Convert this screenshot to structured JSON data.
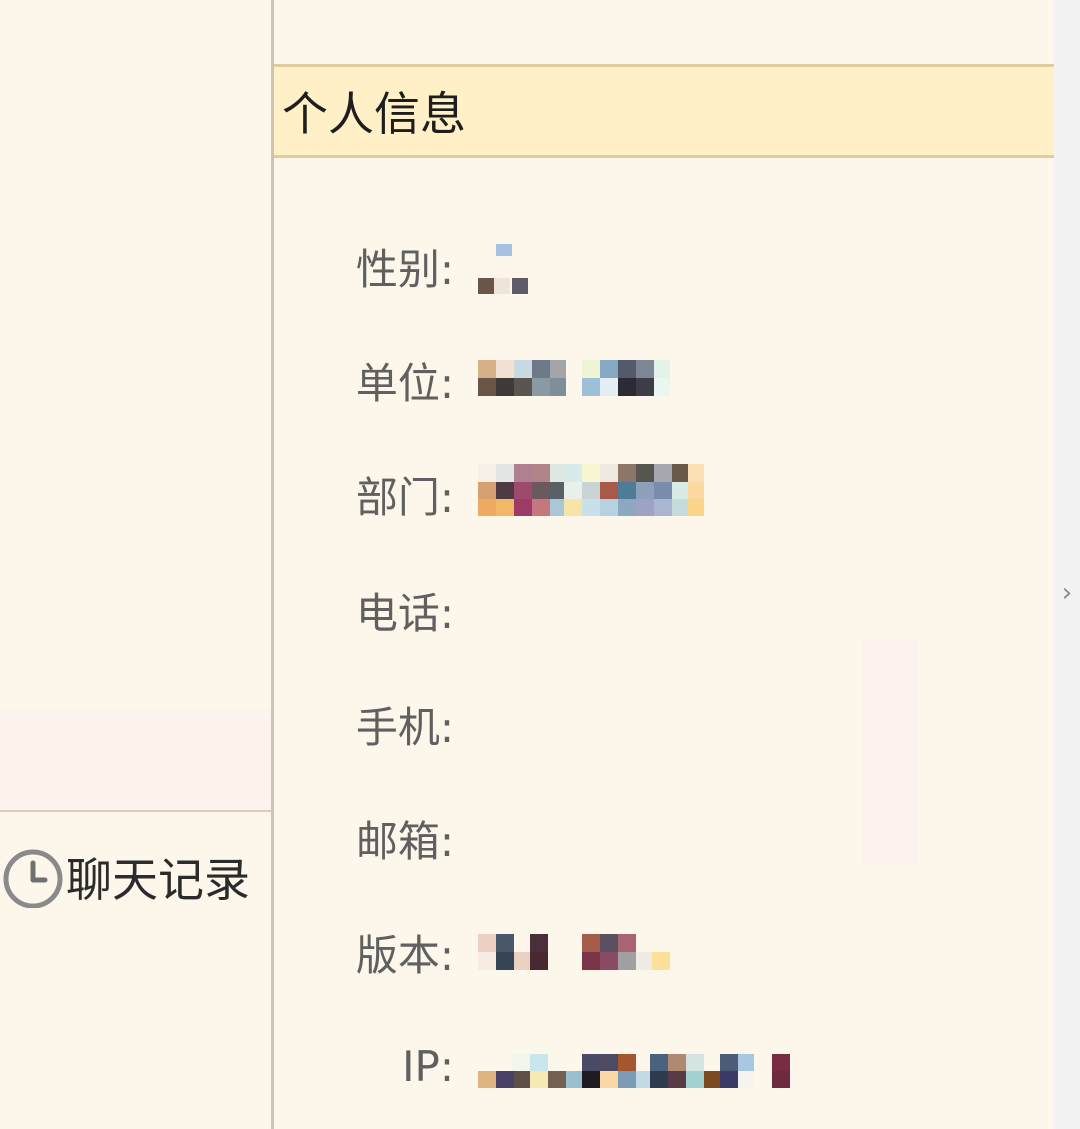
{
  "window": {
    "left_panel": {
      "chat_history": {
        "label": "聊天记录",
        "icon": "clock-icon"
      }
    },
    "main": {
      "title": "个人信息",
      "fields": [
        {
          "key": "gender",
          "label": "性别:",
          "value_redacted": true
        },
        {
          "key": "unit",
          "label": "单位:",
          "value_redacted": true
        },
        {
          "key": "department",
          "label": "部门:",
          "value_redacted": true
        },
        {
          "key": "phone",
          "label": "电话:",
          "value": ""
        },
        {
          "key": "mobile",
          "label": "手机:",
          "value": ""
        },
        {
          "key": "email",
          "label": "邮箱:",
          "value": ""
        },
        {
          "key": "version",
          "label": "版本:",
          "value_redacted": true
        },
        {
          "key": "ip",
          "label": "IP:",
          "value_redacted": true
        }
      ]
    },
    "right_strip": {
      "icon": "chevron-right-icon"
    }
  },
  "colors": {
    "background": "#fdf6ea",
    "header_bg": "#fff0c8",
    "header_border": "#e0cc9e",
    "label_text": "#606060",
    "title_text": "#1e1e1e",
    "divider": "#cfc3b2"
  }
}
